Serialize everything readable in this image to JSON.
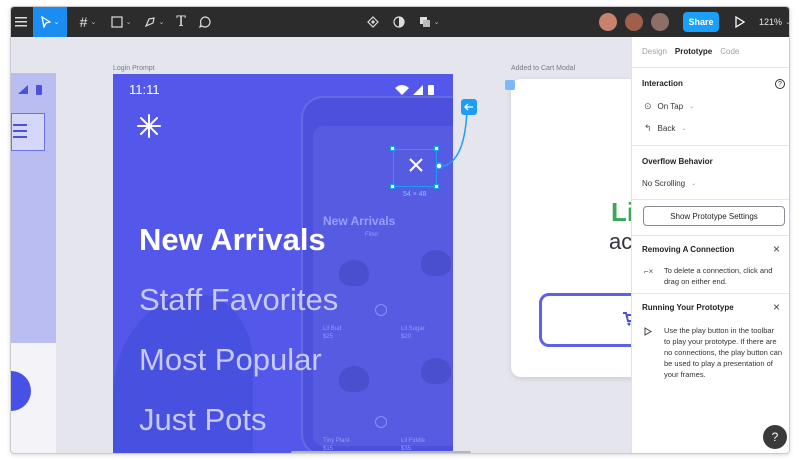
{
  "toolbar": {
    "share_label": "Share",
    "zoom_label": "121%",
    "colors": {
      "background": "#2c2c2c",
      "active_tool": "#1b8df0",
      "share": "#18a0fb"
    }
  },
  "canvas": {
    "login_frame_label": "Login Prompt",
    "modal_frame_label": "Added to Cart Modal",
    "login": {
      "time": "11:11",
      "menu": [
        "New Arrivals",
        "Staff Favorites",
        "Most Popular",
        "Just Pots"
      ]
    },
    "selection_size": "54 × 48",
    "modal": {
      "heading_partial": "Li",
      "body_partial": "ac"
    },
    "ghost": {
      "title": "New Arrivals",
      "filter": "Filter",
      "products": [
        "Lil Bud",
        "Lil Sugar",
        "Tiny Plant",
        "Lil Fiddle"
      ],
      "prices": [
        "$25",
        "$20",
        "$15",
        "$35"
      ]
    },
    "colors": {
      "login_bg": "#5358ea",
      "modal_green": "#3aa856",
      "selection": "#1f9cf7"
    }
  },
  "panel": {
    "tabs": [
      "Design",
      "Prototype",
      "Code"
    ],
    "active_tab": "Prototype",
    "interaction": {
      "title": "Interaction",
      "trigger": "On Tap",
      "action": "Back"
    },
    "overflow": {
      "title": "Overflow Behavior",
      "value": "No Scrolling"
    },
    "settings_button": "Show Prototype Settings",
    "tip_remove": {
      "title": "Removing A Connection",
      "body": "To delete a connection, click and drag on either end."
    },
    "tip_run": {
      "title": "Running Your Prototype",
      "body": "Use the play button in the toolbar to play your prototype. If there are no connections, the play button can be used to play a presentation of your frames."
    },
    "help_label": "?"
  }
}
